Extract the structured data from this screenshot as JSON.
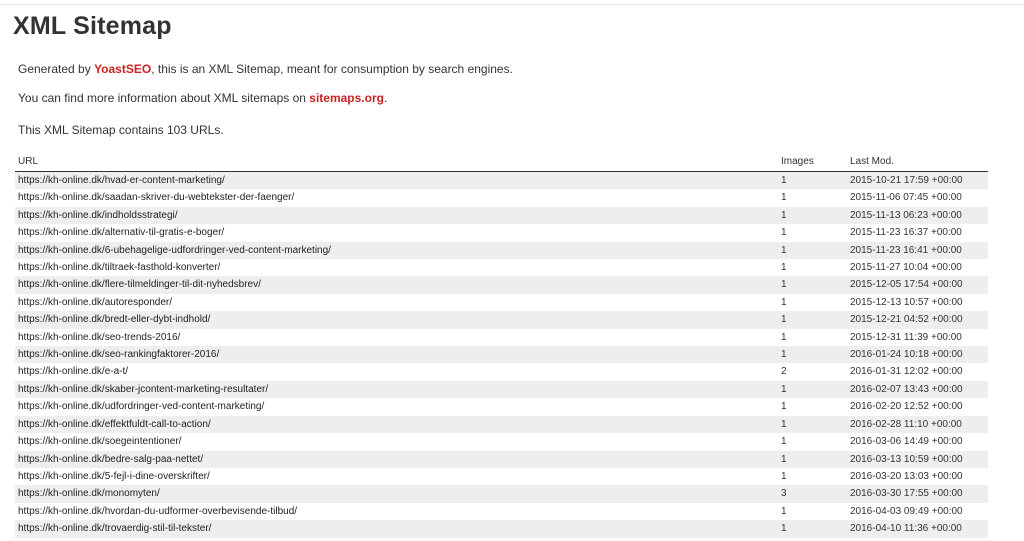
{
  "title": "XML Sitemap",
  "intro": {
    "generated_prefix": "Generated by ",
    "generated_link": "YoastSEO",
    "generated_suffix": ", this is an XML Sitemap, meant for consumption by search engines.",
    "info_prefix": "You can find more information about XML sitemaps on ",
    "info_link": "sitemaps.org",
    "info_suffix": ".",
    "count_text": "This XML Sitemap contains 103 URLs."
  },
  "table": {
    "headers": {
      "url": "URL",
      "images": "Images",
      "lastmod": "Last Mod."
    },
    "rows": [
      {
        "url": "https://kh-online.dk/hvad-er-content-marketing/",
        "images": "1",
        "lastmod": "2015-10-21 17:59 +00:00"
      },
      {
        "url": "https://kh-online.dk/saadan-skriver-du-webtekster-der-faenger/",
        "images": "1",
        "lastmod": "2015-11-06 07:45 +00:00"
      },
      {
        "url": "https://kh-online.dk/indholdsstrategi/",
        "images": "1",
        "lastmod": "2015-11-13 06:23 +00:00"
      },
      {
        "url": "https://kh-online.dk/alternativ-til-gratis-e-boger/",
        "images": "1",
        "lastmod": "2015-11-23 16:37 +00:00"
      },
      {
        "url": "https://kh-online.dk/6-ubehagelige-udfordringer-ved-content-marketing/",
        "images": "1",
        "lastmod": "2015-11-23 16:41 +00:00"
      },
      {
        "url": "https://kh-online.dk/tiltraek-fasthold-konverter/",
        "images": "1",
        "lastmod": "2015-11-27 10:04 +00:00"
      },
      {
        "url": "https://kh-online.dk/flere-tilmeldinger-til-dit-nyhedsbrev/",
        "images": "1",
        "lastmod": "2015-12-05 17:54 +00:00"
      },
      {
        "url": "https://kh-online.dk/autoresponder/",
        "images": "1",
        "lastmod": "2015-12-13 10:57 +00:00"
      },
      {
        "url": "https://kh-online.dk/bredt-eller-dybt-indhold/",
        "images": "1",
        "lastmod": "2015-12-21 04:52 +00:00"
      },
      {
        "url": "https://kh-online.dk/seo-trends-2016/",
        "images": "1",
        "lastmod": "2015-12-31 11:39 +00:00"
      },
      {
        "url": "https://kh-online.dk/seo-rankingfaktorer-2016/",
        "images": "1",
        "lastmod": "2016-01-24 10:18 +00:00"
      },
      {
        "url": "https://kh-online.dk/e-a-t/",
        "images": "2",
        "lastmod": "2016-01-31 12:02 +00:00"
      },
      {
        "url": "https://kh-online.dk/skaber-jcontent-marketing-resultater/",
        "images": "1",
        "lastmod": "2016-02-07 13:43 +00:00"
      },
      {
        "url": "https://kh-online.dk/udfordringer-ved-content-marketing/",
        "images": "1",
        "lastmod": "2016-02-20 12:52 +00:00"
      },
      {
        "url": "https://kh-online.dk/effektfuldt-call-to-action/",
        "images": "1",
        "lastmod": "2016-02-28 11:10 +00:00"
      },
      {
        "url": "https://kh-online.dk/soegeintentioner/",
        "images": "1",
        "lastmod": "2016-03-06 14:49 +00:00"
      },
      {
        "url": "https://kh-online.dk/bedre-salg-paa-nettet/",
        "images": "1",
        "lastmod": "2016-03-13 10:59 +00:00"
      },
      {
        "url": "https://kh-online.dk/5-fejl-i-dine-overskrifter/",
        "images": "1",
        "lastmod": "2016-03-20 13:03 +00:00"
      },
      {
        "url": "https://kh-online.dk/monomyten/",
        "images": "3",
        "lastmod": "2016-03-30 17:55 +00:00"
      },
      {
        "url": "https://kh-online.dk/hvordan-du-udformer-overbevisende-tilbud/",
        "images": "1",
        "lastmod": "2016-04-03 09:49 +00:00"
      },
      {
        "url": "https://kh-online.dk/trovaerdig-stil-til-tekster/",
        "images": "1",
        "lastmod": "2016-04-10 11:36 +00:00"
      }
    ]
  },
  "colors": {
    "link_accent": "#cc2222",
    "row_stripe": "#eeeeee",
    "text": "#333333"
  }
}
